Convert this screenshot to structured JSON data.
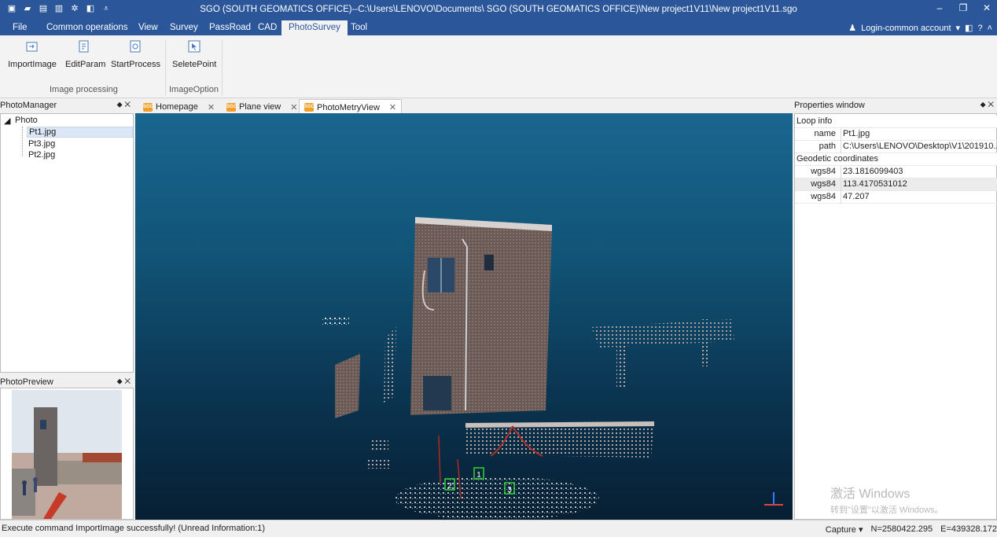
{
  "window": {
    "title": "SGO (SOUTH GEOMATICS OFFICE)--C:\\Users\\LENOVO\\Documents\\ SGO (SOUTH GEOMATICS OFFICE)\\New project1V11\\New project1V11.sgo",
    "controls": {
      "minimize": "–",
      "restore": "❐",
      "close": "✕"
    }
  },
  "quick_access": [
    "new-file-icon",
    "open-folder-icon",
    "save-icon",
    "print-icon",
    "settings-icon",
    "layers-icon",
    "dropdown-icon"
  ],
  "menu": {
    "items": [
      "File",
      "Common operations",
      "View",
      "Survey",
      "PassRoad",
      "CAD",
      "PhotoSurvey",
      "Tool"
    ],
    "active": "PhotoSurvey",
    "login": "Login-common account"
  },
  "ribbon": {
    "buttons": {
      "import": "ImportImage",
      "edit": "EditParam",
      "start": "StartProcess",
      "select": "SeletePoint"
    },
    "groups": {
      "image_processing": "Image processing",
      "image_option": "ImageOption"
    }
  },
  "photo_manager": {
    "title": "PhotoManager",
    "root": "Photo",
    "files": [
      "Pt1.jpg",
      "Pt3.jpg",
      "Pt2.jpg"
    ],
    "selected": "Pt1.jpg"
  },
  "photo_preview": {
    "title": "PhotoPreview"
  },
  "tabs": [
    "Homepage",
    "Plane view",
    "PhotoMetryView"
  ],
  "tab_logo": "SGO",
  "active_tab": "PhotoMetryView",
  "view3d": {
    "markers": [
      "2",
      "1",
      "3"
    ]
  },
  "properties": {
    "title": "Properties window",
    "loop_info": "Loop info",
    "name_key": "name",
    "name_val": "Pt1.jpg",
    "path_key": "path",
    "path_val": "C:\\Users\\LENOVO\\Desktop\\V1\\201910...",
    "geodetic": "Geodetic coordinates",
    "wgs_key": "wgs84",
    "lat": "23.1816099403",
    "lon": "113.4170531012",
    "h": "47.207"
  },
  "watermark": {
    "line1": "激活 Windows",
    "line2": "转到\"设置\"以激活 Windows。"
  },
  "status": {
    "message": "Execute command ImportImage successfully! (Unread Information:1)",
    "capture": "Capture",
    "north": "N=2580422.295",
    "east": "E=439328.172"
  }
}
